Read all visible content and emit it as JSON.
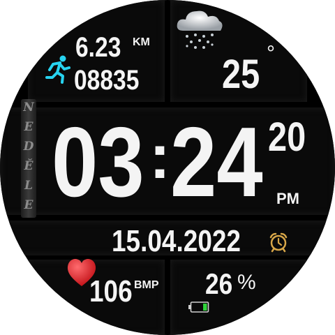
{
  "steps": {
    "distance_value": "6.23",
    "distance_unit": "KM",
    "count": "08835"
  },
  "weather": {
    "temperature": "25",
    "unit": "°"
  },
  "day": {
    "letters": [
      "N",
      "E",
      "D",
      "Ě",
      "L",
      "E"
    ]
  },
  "time": {
    "hours": "03",
    "separator": ":",
    "minutes": "24",
    "seconds": "20",
    "ampm": "PM"
  },
  "date": {
    "value": "15.04.2022"
  },
  "heart": {
    "value": "106",
    "unit": "BMP"
  },
  "battery": {
    "value": "26",
    "unit": "%",
    "level_fraction": 0.26
  },
  "icons": {
    "runner": "running-person-icon",
    "weather": "snow-cloud-icon",
    "alarm": "alarm-clock-icon",
    "heart": "heart-icon",
    "battery": "battery-icon"
  },
  "colors": {
    "accent_cyan": "#27d3f0",
    "heart_red": "#e31f24",
    "alarm_gold": "#d7a648",
    "battery_green": "#2fd33a",
    "text": "#f4f4f4"
  }
}
